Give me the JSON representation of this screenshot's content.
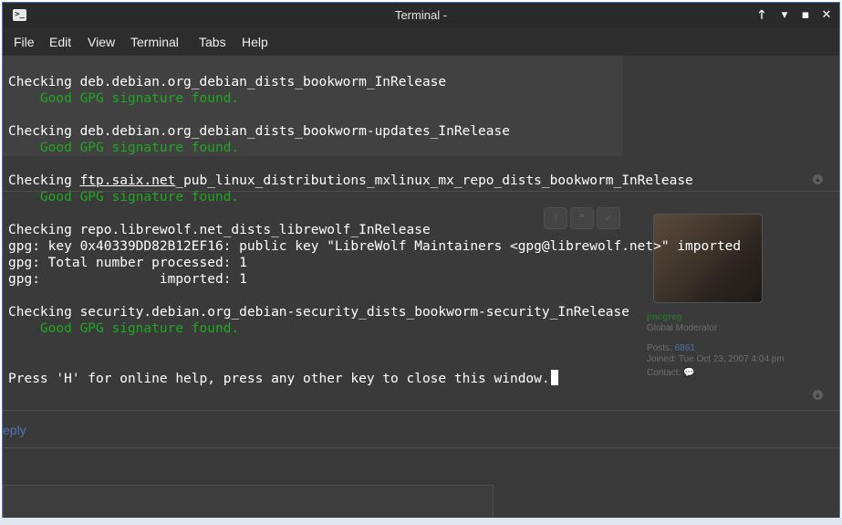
{
  "window": {
    "title": "Terminal -",
    "icon": "terminal-icon"
  },
  "window_controls": {
    "keep_above": "🡑",
    "minimize": "▾",
    "maximize": "▪",
    "close": "✕"
  },
  "menu": {
    "file": "File",
    "edit": "Edit",
    "view": "View",
    "terminal": "Terminal",
    "tabs": "Tabs",
    "help": "Help"
  },
  "terminal": {
    "lines": [
      {
        "text": "Checking deb.debian.org_debian_dists_bookworm_InRelease",
        "style": "normal"
      },
      {
        "text": "    Good GPG signature found.",
        "style": "green"
      },
      {
        "text": "",
        "style": "normal"
      },
      {
        "text": "Checking deb.debian.org_debian_dists_bookworm-updates_InRelease",
        "style": "normal"
      },
      {
        "text": "    Good GPG signature found.",
        "style": "green"
      },
      {
        "text": "",
        "style": "normal"
      },
      {
        "text_prefix": "Checking ",
        "text_link": "ftp.saix.net",
        "text_suffix": "_pub_linux_distributions_mxlinux_mx_repo_dists_bookworm_InRelease",
        "style": "link"
      },
      {
        "text": "    Good GPG signature found.",
        "style": "green"
      },
      {
        "text": "",
        "style": "normal"
      },
      {
        "text": "Checking repo.librewolf.net_dists_librewolf_InRelease",
        "style": "normal"
      },
      {
        "text": "gpg: key 0x40339DD82B12EF16: public key \"LibreWolf Maintainers <gpg@librewolf.net>\" imported",
        "style": "normal"
      },
      {
        "text": "gpg: Total number processed: 1",
        "style": "normal"
      },
      {
        "text": "gpg:               imported: 1",
        "style": "normal"
      },
      {
        "text": "",
        "style": "normal"
      },
      {
        "text": "Checking security.debian.org_debian-security_dists_bookworm-security_InRelease",
        "style": "normal"
      },
      {
        "text": "    Good GPG signature found.",
        "style": "green"
      },
      {
        "text": "",
        "style": "normal"
      },
      {
        "text": "",
        "style": "normal"
      },
      {
        "text": "Press 'H' for online help, press any other key to close this window.",
        "style": "prompt"
      }
    ]
  },
  "background_page": {
    "username": "jmcgreg",
    "rank": "Global Moderator",
    "posts_label": "Posts:",
    "posts_value": "6861",
    "joined_label": "Joined:",
    "joined_value": "Tue Oct 23, 2007 4:04 pm",
    "contact_label": "Contact:",
    "reply_text": "eply"
  },
  "colors": {
    "terminal_bg": "#3a3a3a",
    "terminal_fg": "#ffffff",
    "green": "#1fa81f",
    "titlebar": "#2a2a2a"
  }
}
